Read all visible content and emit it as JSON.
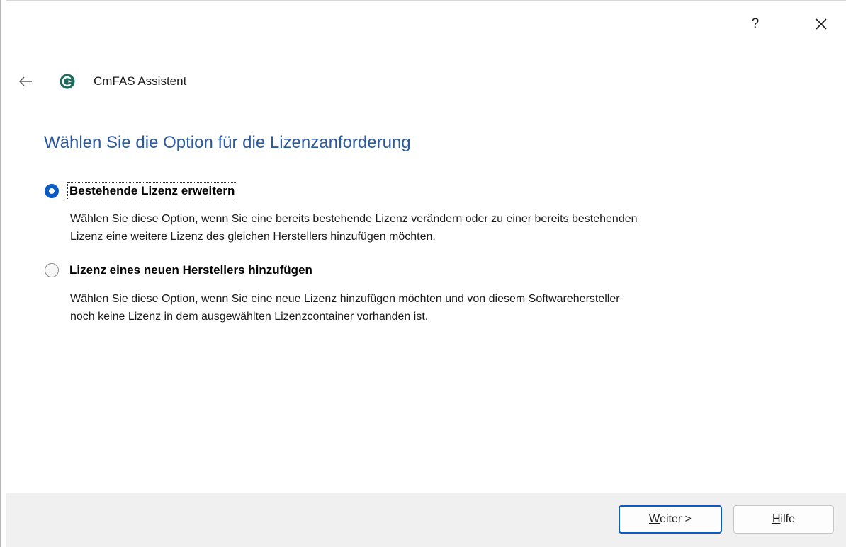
{
  "titlebar": {
    "help_label": "?",
    "close_icon": "close-icon"
  },
  "header": {
    "back_icon": "arrow-left-icon",
    "app_icon": "cmfas-logo-icon",
    "title": "CmFAS Assistent"
  },
  "page": {
    "heading": "Wählen Sie die Option für die Lizenzanforderung"
  },
  "options": [
    {
      "label": "Bestehende Lizenz erweitern",
      "selected": true,
      "description_line1": "Wählen Sie diese Option, wenn Sie eine bereits bestehende Lizenz verändern oder zu einer bereits bestehenden",
      "description_line2": "Lizenz eine weitere Lizenz des gleichen Herstellers hinzufügen möchten."
    },
    {
      "label": "Lizenz eines neuen Herstellers hinzufügen",
      "selected": false,
      "description_line1": "Wählen Sie diese Option, wenn Sie eine neue Lizenz hinzufügen möchten und von diesem Softwarehersteller",
      "description_line2": "noch keine Lizenz in dem ausgewählten Lizenzcontainer vorhanden ist."
    }
  ],
  "footer": {
    "next_mnemonic": "W",
    "next_rest": "eiter >",
    "help_mnemonic": "H",
    "help_rest": "ilfe"
  },
  "colors": {
    "heading": "#2b5aa0",
    "accent": "#0a5bc4",
    "app_icon_bg": "#1f6b5e"
  }
}
